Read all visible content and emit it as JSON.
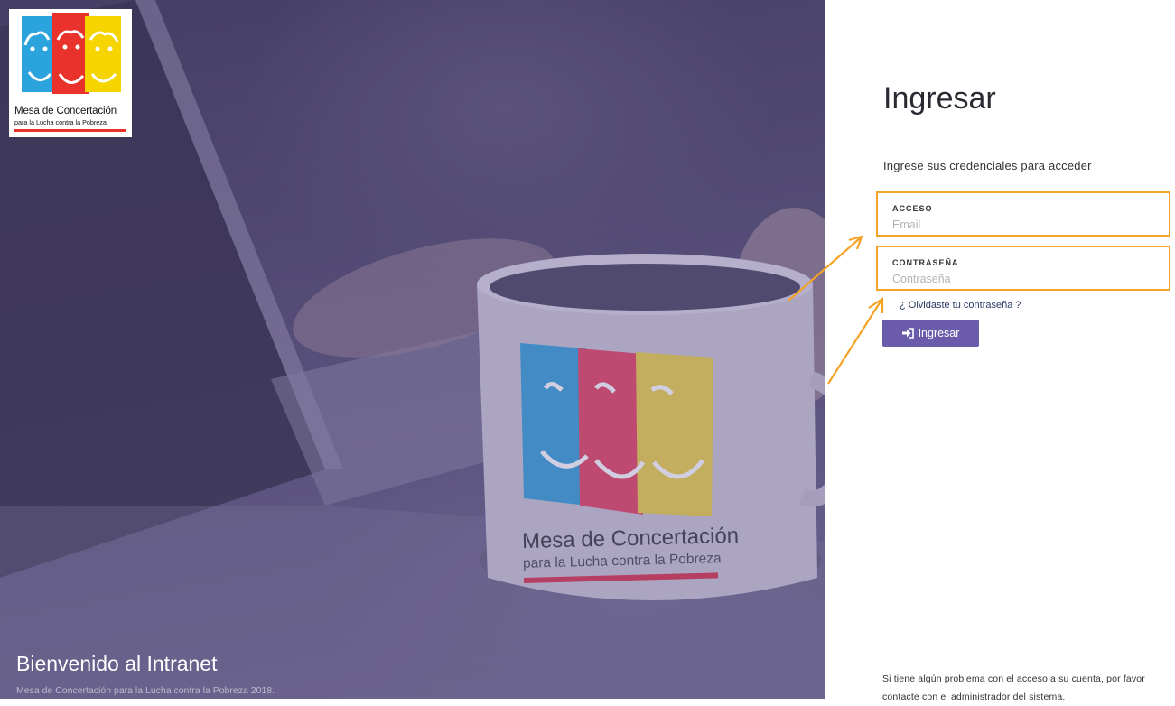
{
  "hero": {
    "logo": {
      "title": "Mesa de Concertación",
      "subtitle": "para la Lucha contra la Pobreza",
      "colors": [
        "#2ba3dc",
        "#e8322b",
        "#f5d400"
      ]
    },
    "mug_text": {
      "title": "Mesa de Concertación",
      "subtitle": "para la Lucha contra la Pobreza"
    },
    "welcome": "Bienvenido al Intranet",
    "caption": "Mesa de Concertación para la Lucha contra la Pobreza 2018."
  },
  "login": {
    "title": "Ingresar",
    "subtitle": "Ingrese sus credenciales para acceder",
    "access": {
      "label": "ACCESO",
      "value": "",
      "placeholder": "Email"
    },
    "password": {
      "label": "CONTRASEÑA",
      "value": "",
      "placeholder": "Contraseña"
    },
    "forgot_link": "¿ Olvidaste tu contraseña ?",
    "button": {
      "label": "Ingresar",
      "icon": "sign-in-icon"
    },
    "help_text": "Si tiene algún problema con el acceso a su cuenta, por favor contacte con el administrador del sistema."
  },
  "colors": {
    "accent_button": "#6b5bab",
    "annotation_orange": "#f5a326",
    "link": "#2b3a64"
  }
}
